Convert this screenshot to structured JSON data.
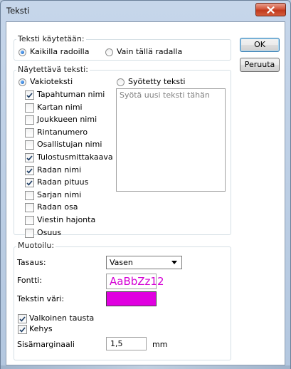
{
  "window": {
    "title": "Teksti"
  },
  "buttons": {
    "ok": "OK",
    "cancel": "Peruuta"
  },
  "usage": {
    "label": "Teksti käytetään:",
    "options": [
      {
        "label": "Kaikilla radoilla",
        "selected": true
      },
      {
        "label": "Vain tällä radalla",
        "selected": false
      }
    ]
  },
  "display_text": {
    "label": "Näytettävä teksti:",
    "standard_option": {
      "label": "Vakioteksti",
      "selected": true
    },
    "custom_option": {
      "label": "Syötetty teksti",
      "selected": false
    },
    "custom_placeholder": "Syötä uusi teksti tähän",
    "fields": [
      {
        "label": "Tapahtuman nimi",
        "checked": true
      },
      {
        "label": "Kartan nimi",
        "checked": false
      },
      {
        "label": "Joukkueen nimi",
        "checked": false
      },
      {
        "label": "Rintanumero",
        "checked": false
      },
      {
        "label": "Osallistujan nimi",
        "checked": false
      },
      {
        "label": "Tulostusmittakaava",
        "checked": true
      },
      {
        "label": "Radan nimi",
        "checked": true
      },
      {
        "label": "Radan pituus",
        "checked": true
      },
      {
        "label": "Sarjan nimi",
        "checked": false
      },
      {
        "label": "Radan osa",
        "checked": false
      },
      {
        "label": "Viestin hajonta",
        "checked": false
      },
      {
        "label": "Osuus",
        "checked": false
      }
    ]
  },
  "formatting": {
    "label": "Muotoilu:",
    "alignment_label": "Tasaus:",
    "alignment_value": "Vasen",
    "font_label": "Fontti:",
    "font_preview": "AaBbZz12",
    "color_label": "Tekstin väri:",
    "text_color": "#e000e0",
    "white_background": {
      "label": "Valkoinen tausta",
      "checked": true
    },
    "frame": {
      "label": "Kehys",
      "checked": true
    },
    "margin_label": "Sisämarginaali",
    "margin_value": "1,5",
    "margin_unit": "mm"
  },
  "icons": {
    "close": "close-icon",
    "dropdown": "chevron-down-icon",
    "check": "checkmark-icon"
  }
}
